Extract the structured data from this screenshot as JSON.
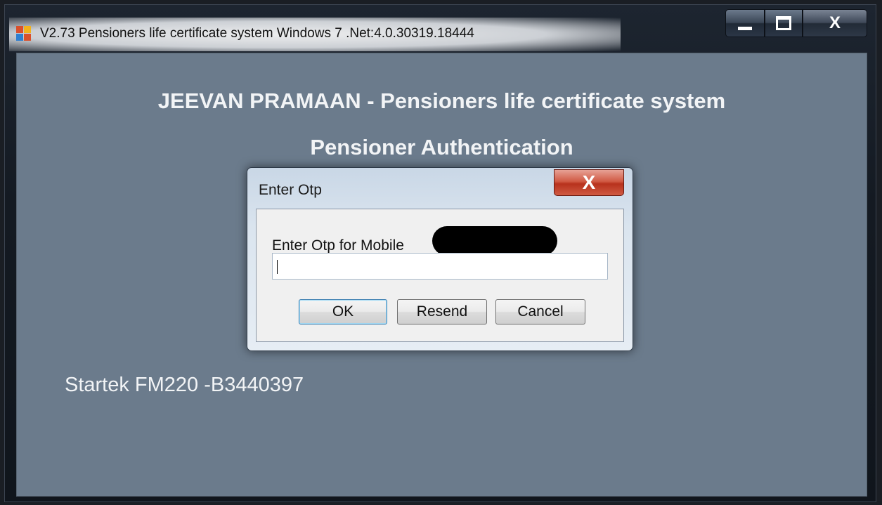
{
  "window": {
    "title": "V2.73 Pensioners life certificate system Windows 7 .Net:4.0.30319.18444",
    "icon": "app-icon",
    "controls": {
      "minimize": "—",
      "maximize": "☐",
      "close": "X"
    }
  },
  "main": {
    "heading": "JEEVAN PRAMAAN - Pensioners life certificate system",
    "subheading": "Pensioner Authentication",
    "device": "Startek FM220 -B3440397"
  },
  "dialog": {
    "title": "Enter Otp",
    "close": "X",
    "label": "Enter Otp for Mobile",
    "input_value": "",
    "buttons": {
      "ok": "OK",
      "resend": "Resend",
      "cancel": "Cancel"
    }
  },
  "colors": {
    "client_bg": "#6b7b8c",
    "text_light": "#f2f4f6",
    "dialog_close": "#c94a33",
    "ok_focus": "#3c7fb1"
  }
}
